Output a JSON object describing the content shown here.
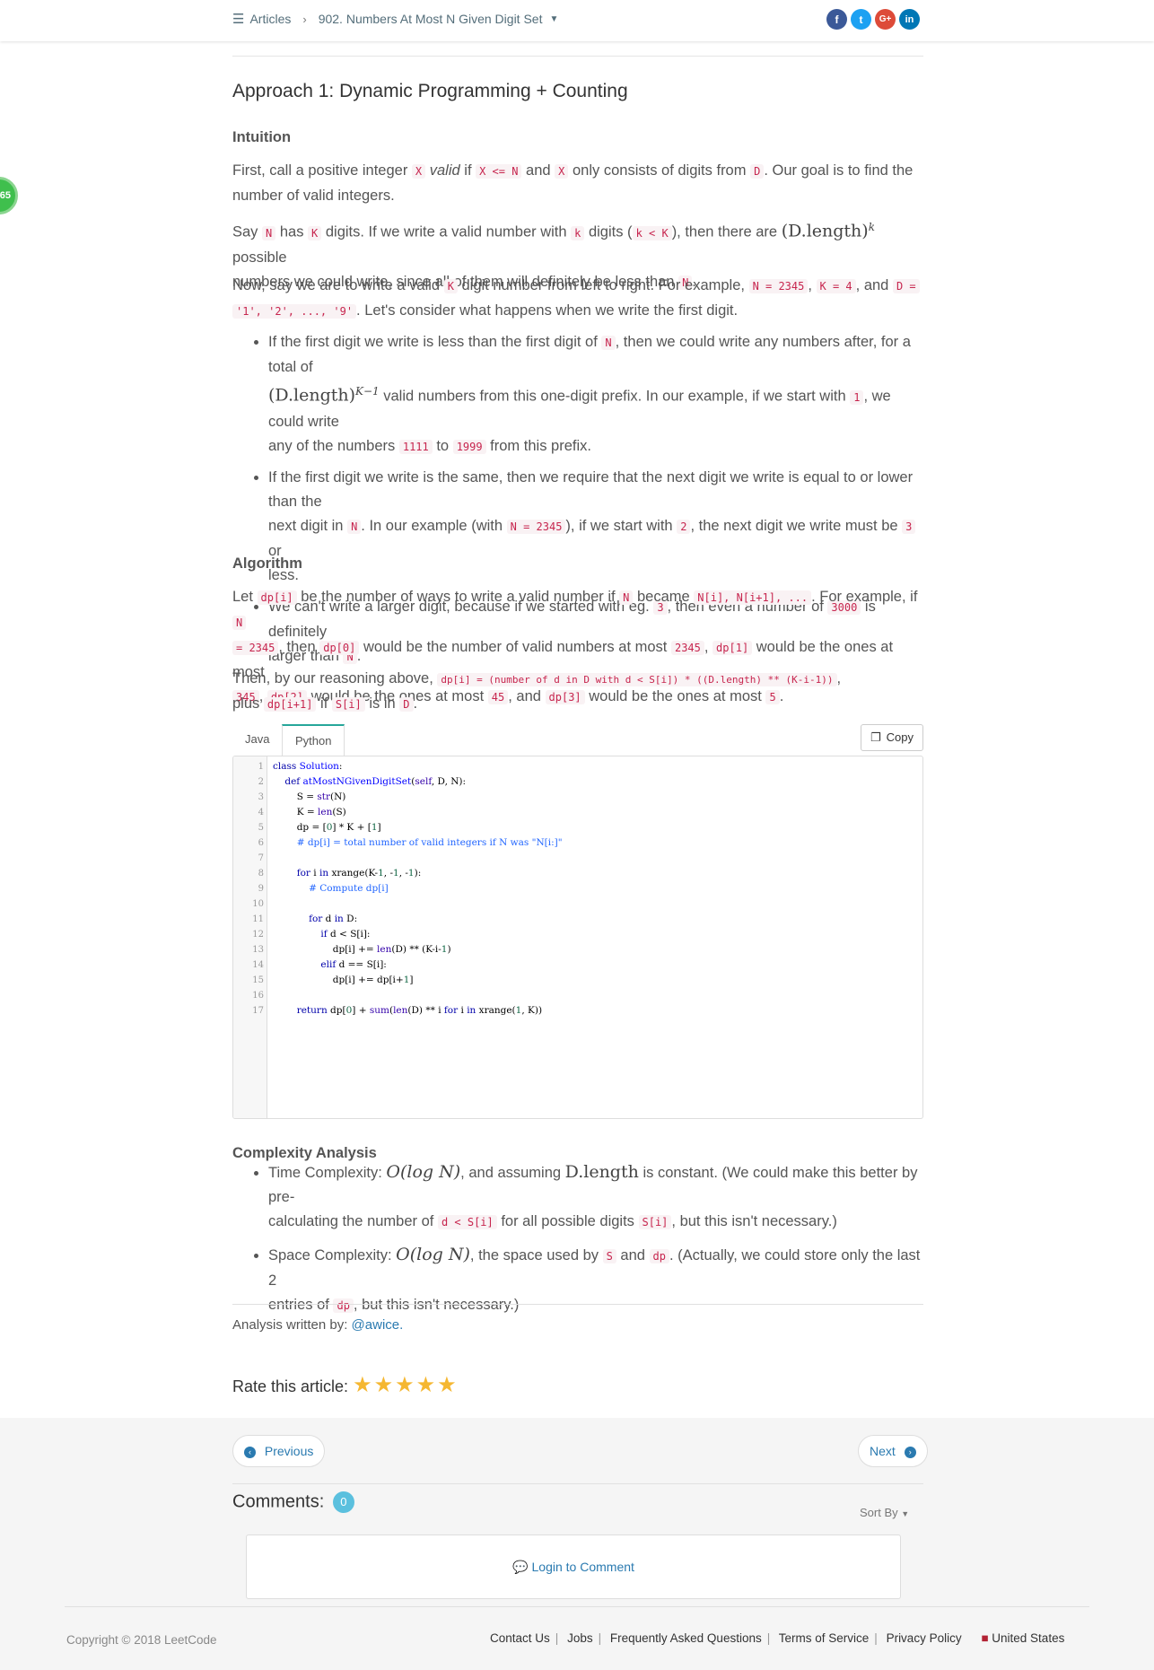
{
  "nav": {
    "articles": "Articles",
    "title": "902. Numbers At Most N Given Digit Set",
    "social": [
      "f",
      "t",
      "G+",
      "in"
    ],
    "social_colors": [
      "#3b5998",
      "#1da1f2",
      "#dd4b39",
      "#0077b5"
    ]
  },
  "side_badge": "65",
  "article": {
    "heading": "Approach 1: Dynamic Programming + Counting",
    "intuition_heading": "Intuition",
    "p1": {
      "a": "First, call a positive integer ",
      "c1": "X",
      "b": "valid",
      "c": " if ",
      "c2": "X <= N",
      "d": " and ",
      "c3": "X",
      "e": " only consists of digits from ",
      "c4": "D",
      "f": ". Our goal is to find the",
      "g": "number of valid integers."
    },
    "p2": {
      "a": "Say ",
      "c1": "N",
      "b": " has ",
      "c2": "K",
      "c": " digits. If we write a valid number with ",
      "c3": "k",
      "d": " digits (",
      "c4": "k < K",
      "e": "), then there are ",
      "m": "(D.length)",
      "sup": "k",
      "f": " possible",
      "g": "numbers we could write, since all of them will definitely be less than ",
      "c5": "N",
      "h": "."
    },
    "p3": {
      "a": "Now, say we are to write a valid ",
      "c1": "K",
      "b": " digit number from left to right. For example, ",
      "c2": "N = 2345",
      "c": ", ",
      "c3": "K = 4",
      "d": ", and ",
      "c4": "D =",
      "c5": "'1', '2', ..., '9'",
      "e": ". Let's consider what happens when we write the first digit."
    },
    "bullets1": {
      "b1": {
        "a": "If the first digit we write is less than the first digit of ",
        "c1": "N",
        "b": ", then we could write any numbers after, for a total of",
        "m": "(D.length)",
        "sup": "K−1",
        "c": " valid numbers from this one-digit prefix. In our example, if we start with ",
        "c2": "1",
        "d": ", we could write",
        "e": "any of the numbers ",
        "c3": "1111",
        "f": " to ",
        "c4": "1999",
        "g": " from this prefix."
      },
      "b2": {
        "a": "If the first digit we write is the same, then we require that the next digit we write is equal to or lower than the",
        "b": "next digit in ",
        "c1": "N",
        "c": ". In our example (with ",
        "c2": "N = 2345",
        "d": "), if we start with ",
        "c3": "2",
        "e": ", the next digit we write must be ",
        "c4": "3",
        "f": " or",
        "g": "less."
      },
      "b3": {
        "a": "We can't write a larger digit, because if we started with eg. ",
        "c1": "3",
        "b": ", then even a number of ",
        "c2": "3000",
        "c": " is definitely",
        "d": "larger than ",
        "c3": "N",
        "e": "."
      }
    },
    "algorithm_heading": "Algorithm",
    "p4": {
      "a": "Let ",
      "c1": "dp[i]",
      "b": " be the number of ways to write a valid number if ",
      "c2": "N",
      "c": " became ",
      "c3": "N[i], N[i+1], ...",
      "d": ". For example, if ",
      "c4": "N",
      "c5": "= 2345",
      "e": ", then ",
      "c6": "dp[0]",
      "f": " would be the number of valid numbers at most ",
      "c7": "2345",
      "g": ", ",
      "c8": "dp[1]",
      "h": " would be the ones at most",
      "c9": "345",
      "i": ", ",
      "c10": "dp[2]",
      "j": " would be the ones at most ",
      "c11": "45",
      "k": ", and ",
      "c12": "dp[3]",
      "l": " would be the ones at most ",
      "c13": "5",
      "m": "."
    },
    "p5": {
      "a": "Then, by our reasoning above, ",
      "c1": "dp[i] = (number of d in D with d < S[i]) * ((D.length) ** (K-i-1))",
      "b": ",",
      "c": "plus ",
      "c2": "dp[i+1]",
      "d": " if ",
      "c3": "S[i]",
      "e": " is in ",
      "c4": "D",
      "f": "."
    }
  },
  "code": {
    "tabs": [
      "Java",
      "Python"
    ],
    "active_tab": "Python",
    "copy_label": "Copy",
    "line_numbers": [
      "1",
      "2",
      "3",
      "4",
      "5",
      "6",
      "7",
      "8",
      "9",
      "10",
      "11",
      "12",
      "13",
      "14",
      "15",
      "16",
      "17"
    ]
  },
  "complexity": {
    "heading": "Complexity Analysis",
    "t": {
      "a": "Time Complexity: ",
      "m1": "O(log N)",
      "b": ", and assuming ",
      "m2": "D.length",
      "c": " is constant. (We could make this better by pre-",
      "d": "calculating the number of ",
      "c1": "d < S[i]",
      "e": " for all possible digits ",
      "c2": "S[i]",
      "f": ", but this isn't necessary.)"
    },
    "s": {
      "a": "Space Complexity: ",
      "m1": "O(log N)",
      "b": ", the space used by ",
      "c1": "S",
      "c": " and ",
      "c2": "dp",
      "d": ". (Actually, we could store only the last 2",
      "e": "entries of ",
      "c3": "dp",
      "f": ", but this isn't necessary.)"
    }
  },
  "author": {
    "label": "Analysis written by: ",
    "name": "@awice."
  },
  "rate": {
    "label": "Rate this article:",
    "stars": 5
  },
  "pager": {
    "previous": "Previous",
    "next": "Next"
  },
  "comments": {
    "label": "Comments:",
    "count": "0",
    "sort": "Sort By",
    "login": "Login to Comment"
  },
  "footer": {
    "copyright": "Copyright © 2018 LeetCode",
    "links": [
      "Contact Us",
      "Jobs",
      "Frequently Asked Questions",
      "Terms of Service",
      "Privacy Policy"
    ],
    "region": "United States"
  }
}
